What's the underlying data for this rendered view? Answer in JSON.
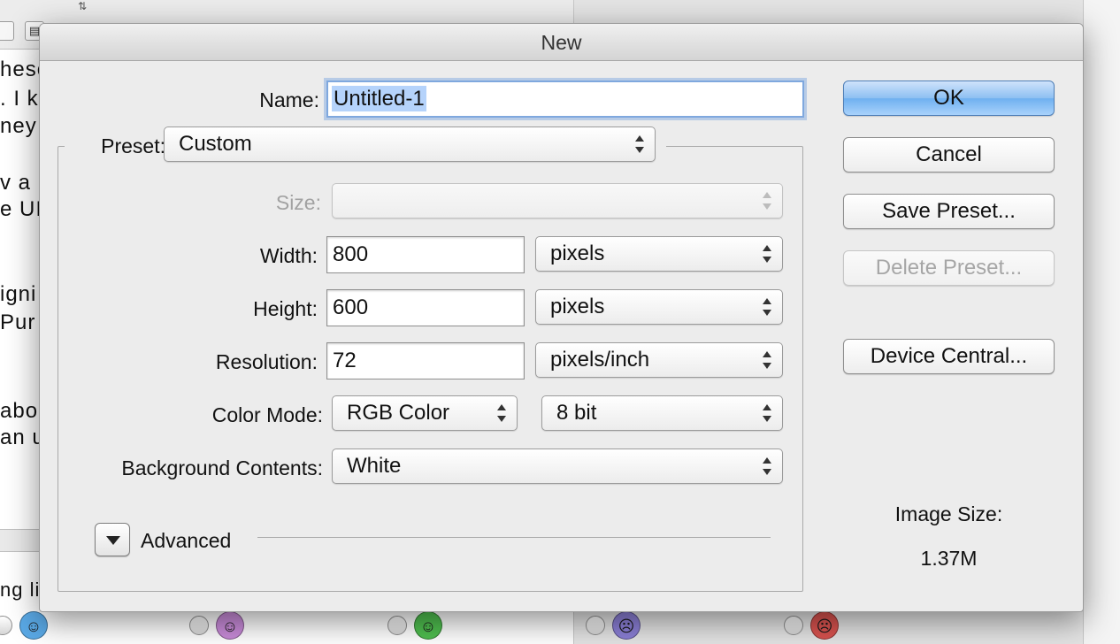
{
  "background": {
    "text_lines": [
      "hese",
      ". I k",
      "ney",
      "",
      "v a p",
      "e UI",
      "",
      "",
      "igni",
      " Pur",
      "",
      "",
      "abo",
      "an u",
      "",
      "",
      "",
      "ng lis"
    ]
  },
  "dialog": {
    "title": "New",
    "name_label": "Name:",
    "name_value": "Untitled-1",
    "preset_label": "Preset:",
    "preset_value": "Custom",
    "size_label": "Size:",
    "size_value": "",
    "width_label": "Width:",
    "width_value": "800",
    "width_unit": "pixels",
    "height_label": "Height:",
    "height_value": "600",
    "height_unit": "pixels",
    "resolution_label": "Resolution:",
    "resolution_value": "72",
    "resolution_unit": "pixels/inch",
    "color_mode_label": "Color Mode:",
    "color_mode_value": "RGB Color",
    "bit_depth_value": "8 bit",
    "background_label": "Background Contents:",
    "background_value": "White",
    "advanced_label": "Advanced",
    "buttons": {
      "ok": "OK",
      "cancel": "Cancel",
      "save_preset": "Save Preset...",
      "delete_preset": "Delete Preset...",
      "device_central": "Device Central..."
    },
    "image_size_label": "Image Size:",
    "image_size_value": "1.37M"
  },
  "emoji_colors": [
    "#5aa9e6",
    "#c98bd9",
    "#4fbf4f",
    "#8b7fd6",
    "#d9534f"
  ]
}
